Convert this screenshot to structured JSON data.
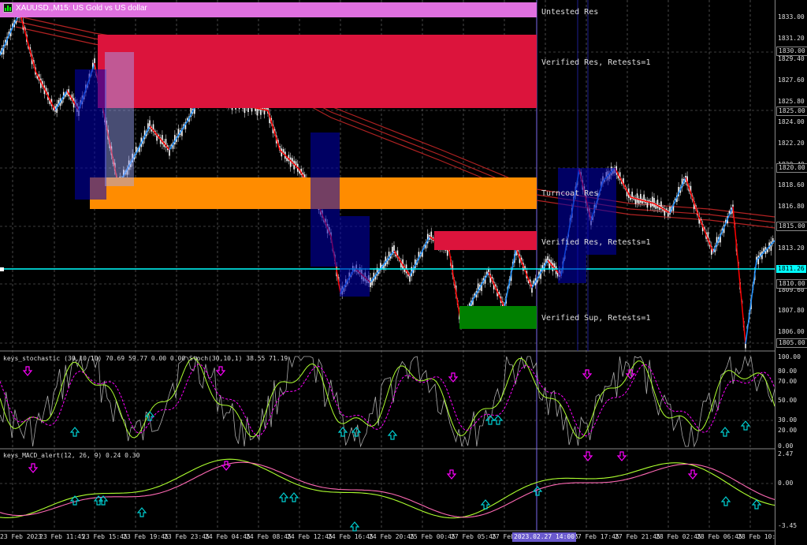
{
  "window": {
    "title": "XAUUSD.,M15:  US Gold vs US dollar"
  },
  "zones": [
    {
      "label": "Untested Res",
      "color": "#e070e0"
    },
    {
      "label": "Verified Res, Retests=1",
      "color": "#dc143c"
    },
    {
      "label": "Turncoat Res",
      "color": "#ff8c00"
    },
    {
      "label": "Verified Res, Retests=1",
      "color": "#dc143c"
    },
    {
      "label": "Verified Sup, Retests=1",
      "color": "#008000"
    }
  ],
  "price_axis": {
    "ticks": [
      "1833.00",
      "1831.20",
      "1829.40",
      "1827.60",
      "1825.80",
      "1824.00",
      "1822.20",
      "1820.40",
      "1818.60",
      "1816.80",
      "1815.00",
      "1813.20",
      "1811.40",
      "1809.60",
      "1807.80",
      "1806.00"
    ],
    "tags": [
      {
        "value": "1830.00",
        "style": "box"
      },
      {
        "value": "1825.00",
        "style": "box"
      },
      {
        "value": "1820.00",
        "style": "box"
      },
      {
        "value": "1815.00",
        "style": "box"
      },
      {
        "value": "1811.26",
        "style": "current"
      },
      {
        "value": "1810.00",
        "style": "box"
      },
      {
        "value": "1805.00",
        "style": "box"
      }
    ]
  },
  "stoch_panel": {
    "label": "keys_stochastic (30,10,10) 70.69 59.77 0.00 0.00 Stoch(30,10,1) 38.55 71.19",
    "ticks": [
      "100.00",
      "80.00",
      "70.00",
      "50.00",
      "30.00",
      "20.00",
      "0.00"
    ]
  },
  "macd_panel": {
    "label": "keys_MACD_alert(12, 26, 9) 0.24 0.30",
    "ticks": [
      "2.47",
      "0.00",
      "-3.45"
    ]
  },
  "time_axis": {
    "labels": [
      "23 Feb 2023",
      "23 Feb 11:45",
      "23 Feb 15:45",
      "23 Feb 19:45",
      "23 Feb 23:45",
      "24 Feb 04:45",
      "24 Feb 08:45",
      "24 Feb 12:45",
      "24 Feb 16:45",
      "24 Feb 20:45",
      "25 Feb 00:45",
      "27 Feb 05:45",
      "27 Feb 09:45",
      "27 Feb 13:45",
      "27 Feb 17:45",
      "27 Feb 21:45",
      "28 Feb 02:45",
      "28 Feb 06:45",
      "28 Feb 10:45"
    ],
    "highlight": "2023.02.27 14:00"
  },
  "colors": {
    "background": "#000000",
    "candle": "#ffffff",
    "zigzag_up": "#1e90ff",
    "zigzag_down": "#ff0000",
    "ma": "#b22222",
    "current_price": "#00ffff",
    "stoch_k": "#adff2f",
    "stoch_d": "#ff00ff",
    "macd": "#adff2f",
    "signal": "#ff69b4",
    "arrow_up": "#00ced1",
    "arrow_down": "#ff00ff"
  }
}
